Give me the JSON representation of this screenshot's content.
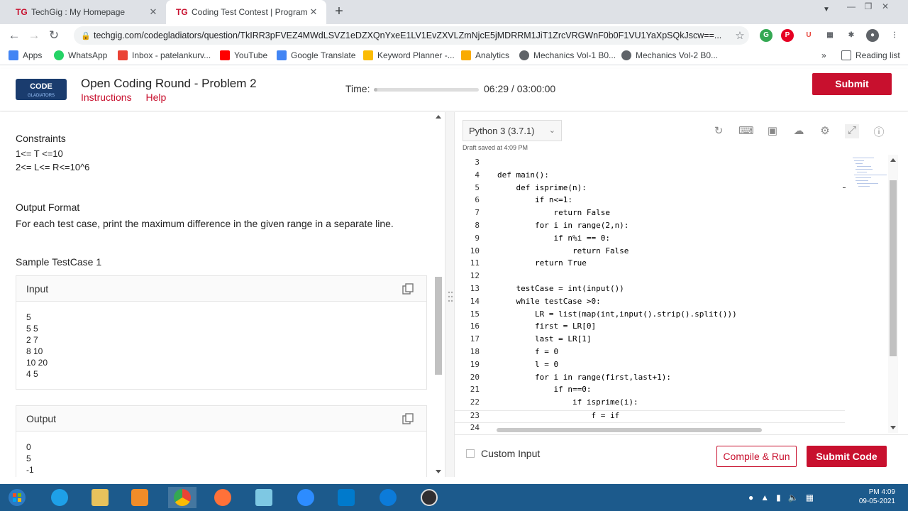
{
  "browser": {
    "tabs": [
      {
        "favicon": "TG",
        "title": "TechGig : My Homepage",
        "close": "✕"
      },
      {
        "favicon": "TG",
        "title": "Coding Test Contest | Programmi",
        "close": "✕"
      }
    ],
    "new_tab": "+",
    "url": "techgig.com/codegladiators/question/TkIRR3pFVEZ4MWdLSVZ1eDZXQnYxeE1LV1EvZXVLZmNjcE5jMDRRM1JiT1ZrcVRGWnF0b0F1VU1YaXpSQkJscw==...",
    "bookmarks": [
      {
        "label": "Apps",
        "color": "#4285f4"
      },
      {
        "label": "WhatsApp",
        "color": "#25d366"
      },
      {
        "label": "Inbox - patelankurv...",
        "color": "#ea4335"
      },
      {
        "label": "YouTube",
        "color": "#ff0000"
      },
      {
        "label": "Google Translate",
        "color": "#4285f4"
      },
      {
        "label": "Keyword Planner -...",
        "color": "#fbbc04"
      },
      {
        "label": "Analytics",
        "color": "#f9ab00"
      },
      {
        "label": "Mechanics Vol-1 B0...",
        "color": "#5f6368"
      },
      {
        "label": "Mechanics Vol-2 B0...",
        "color": "#5f6368"
      }
    ],
    "more_bookmarks": "»",
    "reading_list": "Reading list"
  },
  "header": {
    "logo_text": "CODE GLADIATORS",
    "problem_title": "Open Coding Round - Problem 2",
    "links": [
      "Instructions",
      "Help"
    ],
    "time_label": "Time:",
    "time_value": "06:29 / 03:00:00",
    "time_progress": 0.036,
    "submit_label": "Submit"
  },
  "problem": {
    "constraints_heading": "Constraints",
    "constraints": [
      "1<= T <=10",
      "2<= L<= R<=10^6"
    ],
    "output_format_heading": "Output Format",
    "output_format_text": "For each test case, print the maximum difference in the given range in a separate line.",
    "sample_heading": "Sample TestCase 1",
    "input_label": "Input",
    "input_lines": [
      "5",
      "5 5",
      "2 7",
      "8 10",
      "10 20",
      "4 5"
    ],
    "output_label": "Output",
    "output_lines": [
      "0",
      "5",
      "-1"
    ]
  },
  "editor": {
    "language": "Python 3 (3.7.1)",
    "draft_status": "Draft saved at 4:09 PM",
    "lines": [
      {
        "n": "3",
        "code": ""
      },
      {
        "n": "4",
        "code": "def main():"
      },
      {
        "n": "5",
        "code": "    def isprime(n):"
      },
      {
        "n": "6",
        "code": "        if n<=1:"
      },
      {
        "n": "7",
        "code": "            return False"
      },
      {
        "n": "8",
        "code": "        for i in range(2,n):"
      },
      {
        "n": "9",
        "code": "            if n%i == 0:"
      },
      {
        "n": "10",
        "code": "                return False"
      },
      {
        "n": "11",
        "code": "        return True"
      },
      {
        "n": "12",
        "code": ""
      },
      {
        "n": "13",
        "code": "    testCase = int(input())"
      },
      {
        "n": "14",
        "code": "    while testCase >0:"
      },
      {
        "n": "15",
        "code": "        LR = list(map(int,input().strip().split()))"
      },
      {
        "n": "16",
        "code": "        first = LR[0]"
      },
      {
        "n": "17",
        "code": "        last = LR[1]"
      },
      {
        "n": "18",
        "code": "        f = 0"
      },
      {
        "n": "19",
        "code": "        l = 0"
      },
      {
        "n": "20",
        "code": "        for i in range(first,last+1):"
      },
      {
        "n": "21",
        "code": "            if n==0:"
      },
      {
        "n": "22",
        "code": "                if isprime(i):"
      },
      {
        "n": "23",
        "code": "                    f = if"
      },
      {
        "n": "24",
        "code": ""
      }
    ],
    "custom_input_label": "Custom Input",
    "compile_label": "Compile & Run",
    "submit_code_label": "Submit Code"
  },
  "taskbar": {
    "clock_time": "PM 4:09",
    "clock_date": "09-05-2021"
  },
  "colors": {
    "brand_red": "#c8102e",
    "taskbar_blue": "#1c5a8c"
  }
}
